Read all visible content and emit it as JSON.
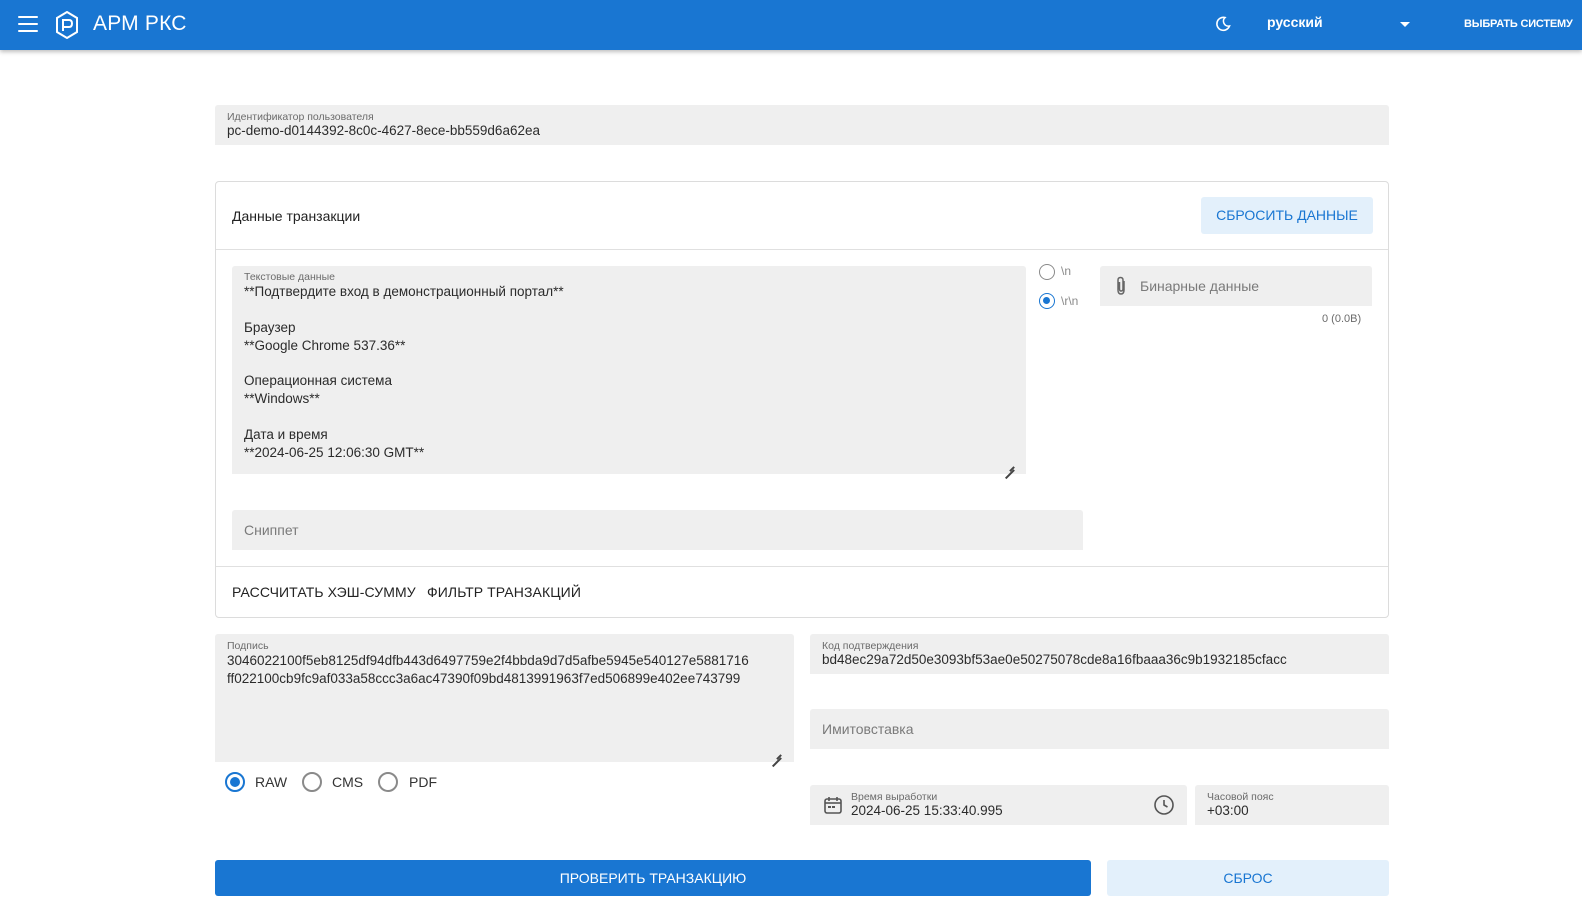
{
  "header": {
    "app_title": "АРМ РКС",
    "language": "русский",
    "choose_system": "ВЫБРАТЬ СИСТЕМУ",
    "colors": {
      "primary": "#1976d2",
      "text": "#ffffff"
    }
  },
  "user_id": {
    "label": "Идентификатор пользователя",
    "value": "pc-demo-d0144392-8c0c-4627-8ece-bb559d6a62ea"
  },
  "transaction": {
    "title": "Данные транзакции",
    "reset_data_button": "СБРОСИТЬ ДАННЫЕ",
    "text_data": {
      "label": "Текстовые данные",
      "lines": [
        "**Подтвердите вход в демонстрационный портал**",
        "",
        "Браузер",
        "**Google Chrome 537.36**",
        "",
        "Операционная система",
        "**Windows**",
        "",
        "Дата и время",
        "**2024-06-25 12:06:30 GMT**"
      ]
    },
    "line_endings": [
      {
        "label": "\\n",
        "selected": false
      },
      {
        "label": "\\r\\n",
        "selected": true
      }
    ],
    "binary_data": {
      "placeholder": "Бинарные данные",
      "size": "0 (0.0B)"
    },
    "snippet_placeholder": "Сниппет",
    "actions": [
      "РАССЧИТАТЬ ХЭШ-СУММУ",
      "ФИЛЬТР ТРАНЗАКЦИЙ"
    ]
  },
  "signature": {
    "label": "Подпись",
    "lines": [
      "3046022100f5eb8125df94dfb443d6497759e2f4bbda9d7d5afbe5945e540127e5881716",
      "ff022100cb9fc9af033a58ccc3a6ac47390f09bd4813991963f7ed506899e402ee743799"
    ],
    "formats": [
      {
        "label": "RAW",
        "selected": true
      },
      {
        "label": "CMS",
        "selected": false
      },
      {
        "label": "PDF",
        "selected": false
      }
    ]
  },
  "confirmation_code": {
    "label": "Код подтверждения",
    "value": "bd48ec29a72d50e3093bf53ae0e50275078cde8a16fbaaa36c9b1932185cfacc"
  },
  "imitovstavka_placeholder": "Имитовставка",
  "generation_time": {
    "label": "Время выработки",
    "value": "2024-06-25 15:33:40.995"
  },
  "timezone": {
    "label": "Часовой пояс",
    "value": "+03:00"
  },
  "verify_button": "ПРОВЕРИТЬ ТРАНЗАКЦИЮ",
  "reset_button": "СБРОС"
}
